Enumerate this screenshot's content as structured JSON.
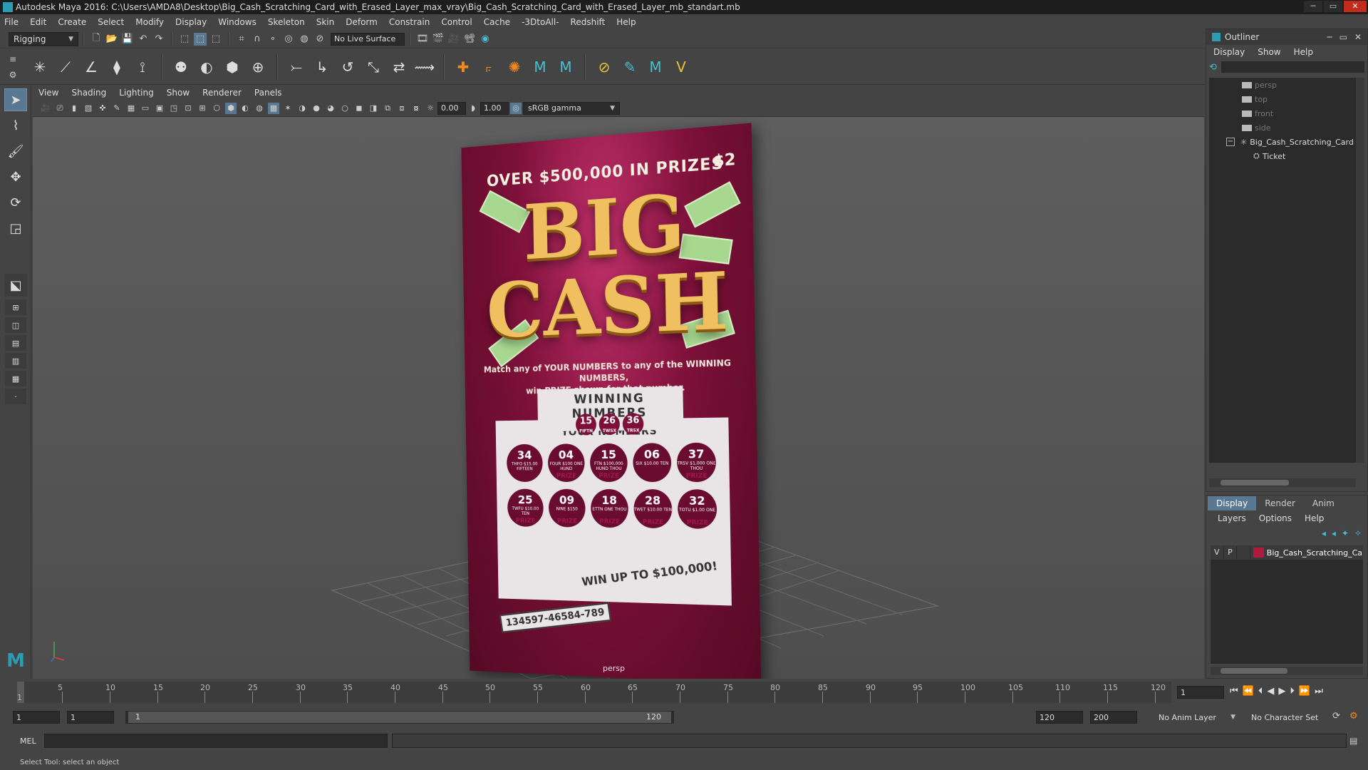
{
  "window": {
    "title": "Autodesk Maya 2016: C:\\Users\\AMDA8\\Desktop\\Big_Cash_Scratching_Card_with_Erased_Layer_max_vray\\Big_Cash_Scratching_Card_with_Erased_Layer_mb_standart.mb",
    "minimize": "─",
    "maximize": "▭",
    "close": "✕"
  },
  "menu": [
    "File",
    "Edit",
    "Create",
    "Select",
    "Modify",
    "Display",
    "Windows",
    "Skeleton",
    "Skin",
    "Deform",
    "Constrain",
    "Control",
    "Cache",
    "-3DtoAll-",
    "Redshift",
    "Help"
  ],
  "statusline": {
    "mode": "Rigging",
    "live_surface": "No Live Surface"
  },
  "viewport": {
    "menu": [
      "View",
      "Shading",
      "Lighting",
      "Show",
      "Renderer",
      "Panels"
    ],
    "exposure": "0.00",
    "gamma": "1.00",
    "color_space": "sRGB gamma",
    "camera_label": "persp"
  },
  "card": {
    "headline": "OVER $500,000 IN PRIZES",
    "price": "$2",
    "big": "BIG",
    "cash": "CASH",
    "match_line1": "Match any of YOUR NUMBERS to any of the WINNING NUMBERS,",
    "match_line2": "win PRIZE shown for that number.",
    "winning_title": "WINNING NUMBERS",
    "winning_numbers": [
      {
        "n": "15",
        "w": "FIFTN"
      },
      {
        "n": "26",
        "w": "TWSX"
      },
      {
        "n": "36",
        "w": "TRSX"
      }
    ],
    "your_title": "YOUR NUMBERS",
    "your_numbers": [
      {
        "n": "34",
        "w": "THFO $15.00 FIFTEEN",
        "p": ""
      },
      {
        "n": "04",
        "w": "FOUR $100 ONE HUND",
        "p": "PRIZE"
      },
      {
        "n": "15",
        "w": "FTN $100,000 HUND THOU",
        "p": "PRIZE"
      },
      {
        "n": "06",
        "w": "SIX $10.00 TEN",
        "p": ""
      },
      {
        "n": "37",
        "w": "TRSV $1,000 ONE THOU",
        "p": "PRIZE"
      },
      {
        "n": "25",
        "w": "TWFU $10.00 TEN",
        "p": "PRIZE"
      },
      {
        "n": "09",
        "w": "NINE $150",
        "p": "PRIZE"
      },
      {
        "n": "18",
        "w": "ETTN ONE THOU",
        "p": "PRIZE"
      },
      {
        "n": "28",
        "w": "TWET $10.00 TEN",
        "p": "PRIZE"
      },
      {
        "n": "32",
        "w": "TOTU $1.00 ONE",
        "p": "PRIZE"
      }
    ],
    "win_up": "WIN UP TO $100,000!",
    "serial": "134597-46584-789"
  },
  "outliner": {
    "title": "Outliner",
    "menu": [
      "Display",
      "Show",
      "Help"
    ],
    "items": [
      {
        "label": "persp",
        "dim": true
      },
      {
        "label": "top",
        "dim": true
      },
      {
        "label": "front",
        "dim": true
      },
      {
        "label": "side",
        "dim": true
      },
      {
        "label": "Big_Cash_Scratching_Card",
        "dim": false
      },
      {
        "label": "Ticket",
        "dim": false
      }
    ],
    "collapse": "−"
  },
  "layers": {
    "tabs": [
      "Display",
      "Render",
      "Anim"
    ],
    "menu": [
      "Layers",
      "Options",
      "Help"
    ],
    "row": {
      "v": "V",
      "p": "P",
      "name": "Big_Cash_Scratching_Card"
    }
  },
  "timeline": {
    "ticks": [
      "5",
      "10",
      "15",
      "20",
      "25",
      "30",
      "35",
      "40",
      "45",
      "50",
      "55",
      "60",
      "65",
      "70",
      "75",
      "80",
      "85",
      "90",
      "95",
      "100",
      "105",
      "110",
      "115",
      "120"
    ],
    "current_frame": "1",
    "current_field": "1"
  },
  "range": {
    "start": "1",
    "start2": "1",
    "range_start": "1",
    "range_end": "120",
    "end": "120",
    "end2": "200",
    "anim_layer": "No Anim Layer",
    "char_set": "No Character Set"
  },
  "cmd": {
    "label": "MEL"
  },
  "help_line": "Select Tool: select an object"
}
